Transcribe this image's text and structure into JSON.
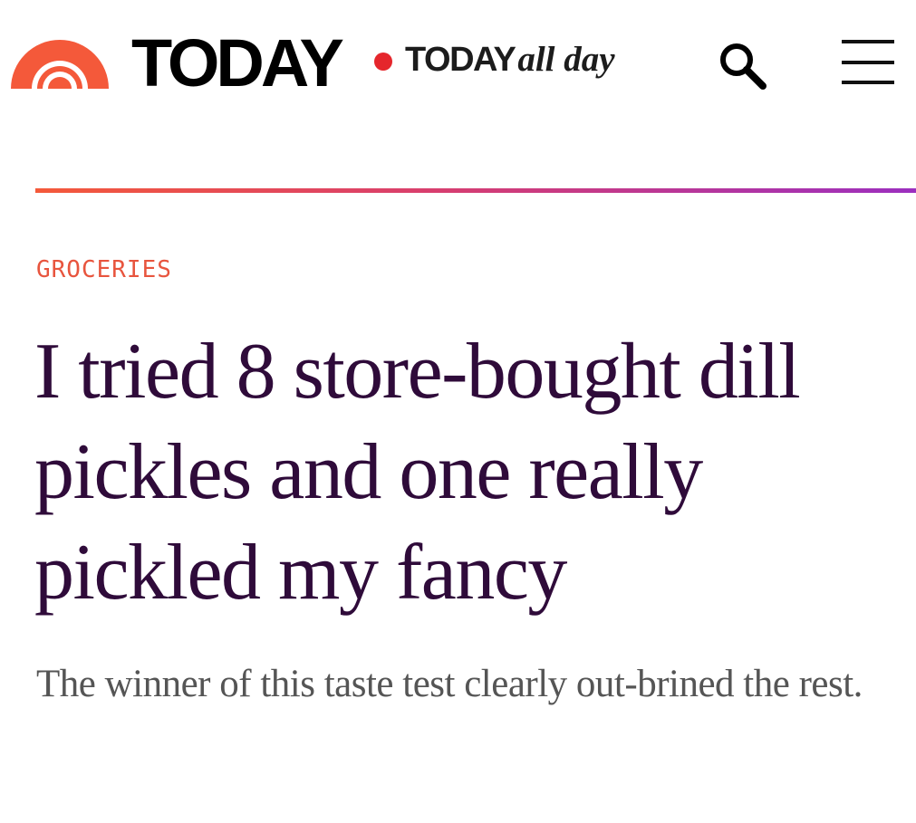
{
  "header": {
    "logo_text": "TODAY",
    "all_day_brand": "TODAY",
    "all_day_tag": "all day",
    "search_icon": "search-icon",
    "menu_icon": "hamburger-menu-icon"
  },
  "article": {
    "category": "GROCERIES",
    "headline": "I tried 8 store-bought dill pickles and one really pickled my fancy",
    "dek": "The winner of this taste test clearly out-brined the rest."
  },
  "colors": {
    "brand_orange": "#f4593a",
    "brand_red_dot": "#e5262c",
    "headline_purple": "#2f0b3a",
    "category_orange": "#e8553e",
    "divider_end_purple": "#9b2fbf"
  }
}
